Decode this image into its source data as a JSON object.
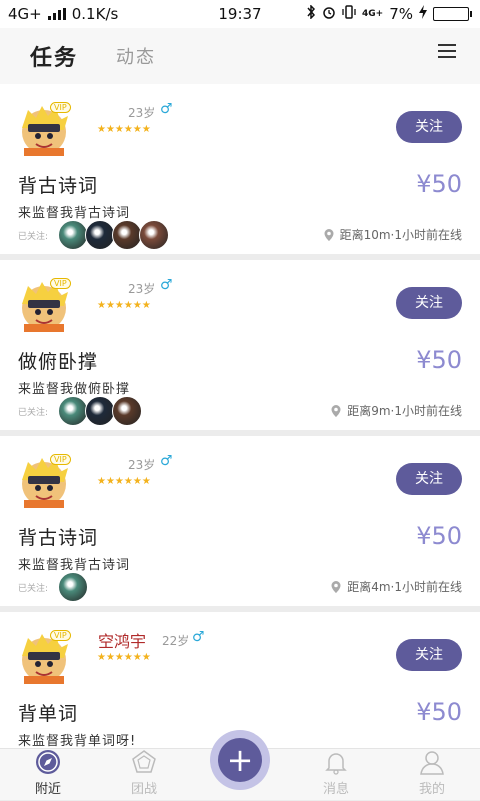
{
  "status_bar": {
    "network": "4G+",
    "speed": "0.1K/s",
    "time": "19:37",
    "battery": "7%",
    "battery_level": 0.07,
    "net_badge": "4G+"
  },
  "header": {
    "tab_active": "任务",
    "tab_inactive": "动态",
    "menu_icon": "hamburger-menu-icon"
  },
  "cards": [
    {
      "username": "",
      "age": "23岁",
      "gender": "♂",
      "stars": "★★★★★★",
      "vip": "VIP",
      "follow_label": "关注",
      "title": "背古诗词",
      "price": "¥50",
      "desc": "来监督我背古诗词",
      "followed_label": "已关注:",
      "followers": [
        "#4a8a7a",
        "#1e2a3a",
        "#5a3a2a",
        "#7a4a3a"
      ],
      "location": "距离10m·1小时前在线"
    },
    {
      "username": "",
      "age": "23岁",
      "gender": "♂",
      "stars": "★★★★★★",
      "vip": "VIP",
      "follow_label": "关注",
      "title": "做俯卧撑",
      "price": "¥50",
      "desc": "来监督我做俯卧撑",
      "followed_label": "已关注:",
      "followers": [
        "#4a8a7a",
        "#1e2a3a",
        "#5a3a2a"
      ],
      "location": "距离9m·1小时前在线"
    },
    {
      "username": "",
      "age": "23岁",
      "gender": "♂",
      "stars": "★★★★★★",
      "vip": "VIP",
      "follow_label": "关注",
      "title": "背古诗词",
      "price": "¥50",
      "desc": "来监督我背古诗词",
      "followed_label": "已关注:",
      "followers": [
        "#4a8a7a"
      ],
      "location": "距离4m·1小时前在线"
    },
    {
      "username": "空鸿宇",
      "age": "22岁",
      "gender": "♂",
      "stars": "★★★★★★",
      "vip": "VIP",
      "follow_label": "关注",
      "title": "背单词",
      "price": "¥50",
      "desc": "来监督我背单词呀!",
      "followed_label": "",
      "followers": [],
      "location": ""
    }
  ],
  "bottom_nav": [
    {
      "label": "附近",
      "icon": "compass-icon",
      "active": true
    },
    {
      "label": "团战",
      "icon": "pentagon-icon",
      "active": false
    },
    {
      "label": "",
      "icon": "plus-icon",
      "active": false
    },
    {
      "label": "消息",
      "icon": "bell-icon",
      "active": false
    },
    {
      "label": "我的",
      "icon": "user-icon",
      "active": false
    }
  ],
  "colors": {
    "accent": "#5e5b9b",
    "price": "#8d8ad0",
    "star": "#f3b21d",
    "gender": "#2aa8d8",
    "username": "#b02a2a"
  }
}
